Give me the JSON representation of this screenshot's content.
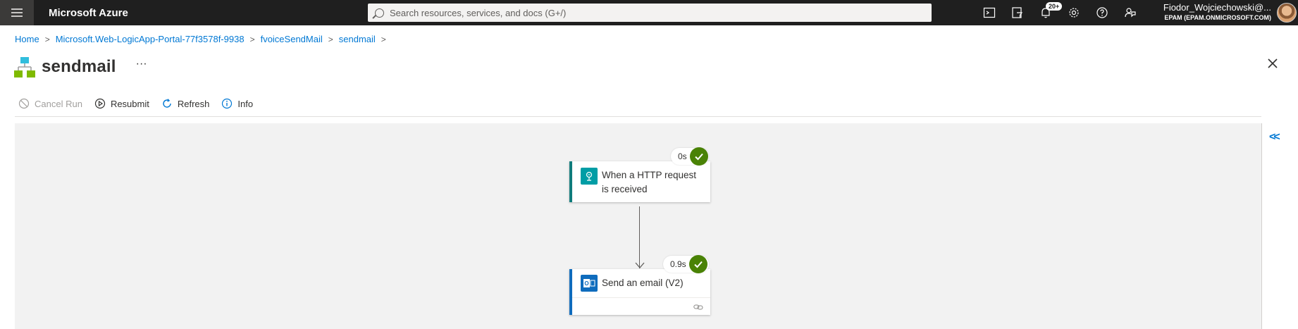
{
  "topbar": {
    "brand": "Microsoft Azure",
    "search_placeholder": "Search resources, services, and docs (G+/)",
    "notifications_badge": "20+",
    "user_name": "Fiodor_Wojciechowski@...",
    "user_org": "EPAM (EPAM.ONMICROSOFT.COM)"
  },
  "breadcrumb": {
    "items": [
      "Home",
      "Microsoft.Web-LogicApp-Portal-77f3578f-9938",
      "fvoiceSendMail",
      "sendmail"
    ]
  },
  "page": {
    "title": "sendmail",
    "more": "···"
  },
  "commands": {
    "cancel_run": "Cancel Run",
    "resubmit": "Resubmit",
    "refresh": "Refresh",
    "info": "Info"
  },
  "workflow": {
    "steps": [
      {
        "title_line1": "When a HTTP request",
        "title_line2": "is received",
        "duration": "0s",
        "status": "succeeded",
        "accent": "#107c7c",
        "icon": "http-request-icon"
      },
      {
        "title_line1": "Send an email (V2)",
        "title_line2": "",
        "duration": "0.9s",
        "status": "succeeded",
        "accent": "#0f6cbd",
        "icon": "outlook-icon"
      }
    ]
  },
  "colors": {
    "accent_blue": "#0078d4",
    "success_green": "#498205",
    "topbar_bg": "#1f1f1f"
  }
}
